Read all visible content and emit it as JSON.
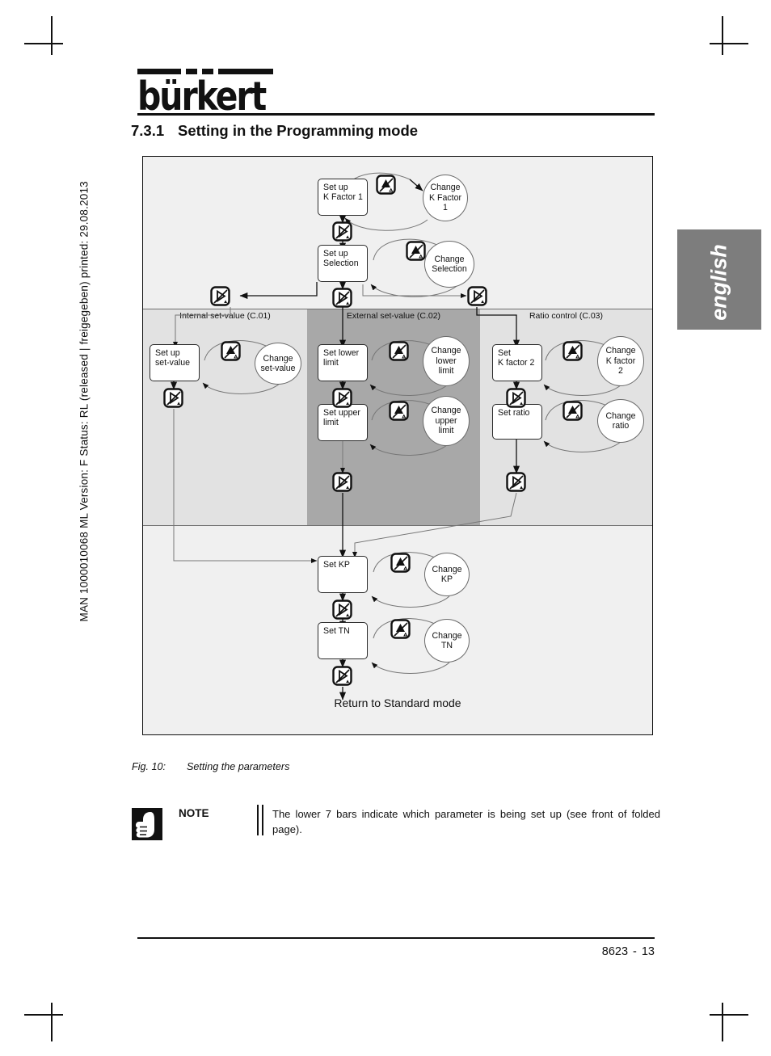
{
  "page": {
    "sidebar_text": "MAN 1000010068  ML  Version: F  Status: RL (released | freigegeben)  printed: 29.08.2013",
    "language_tab": "english",
    "footer_doc": "8623",
    "footer_sep": "-",
    "footer_page": "13",
    "logo_word": "bürkert"
  },
  "heading": {
    "number": "7.3.1",
    "title": "Setting in the Programming mode"
  },
  "caption": {
    "label": "Fig. 10:",
    "text": "Setting the parameters"
  },
  "note": {
    "word": "NOTE",
    "text": "The lower 7 bars indicate which parameter is being set up (see front of folded page).",
    "icon": "hand-thumb-icon"
  },
  "diagram": {
    "return_label": "Return to Standard mode",
    "bands": [
      {
        "label": "Internal set-value (C.01)",
        "shade": "#e2e2e2"
      },
      {
        "label": "External set-value (C.02)",
        "shade": "#a8a8a8"
      },
      {
        "label": "Ratio control (C.03)",
        "shade": "#e2e2e2"
      }
    ],
    "nodes": {
      "setup_kfactor1": "Set up\nK Factor 1",
      "change_kfactor1": "Change\nK Factor\n1",
      "setup_selection": "Set up\nSelection",
      "change_selection": "Change\nSelection",
      "setup_setvalue": "Set up\nset-value",
      "change_setvalue": "Change\nset-value",
      "set_lower_limit": "Set lower\nlimit",
      "change_lower_limit": "Change\nlower\nlimit",
      "set_upper_limit": "Set upper\nlimit",
      "change_upper_limit": "Change\nupper\nlimit",
      "set_kfactor2": "Set\nK factor 2",
      "change_kfactor2": "Change\nK factor\n2",
      "set_ratio": "Set ratio",
      "change_ratio": "Change\nratio",
      "set_kp": "Set KP",
      "change_kp": "Change\nKP",
      "set_tn": "Set TN",
      "change_tn": "Change\nTN"
    },
    "keys": {
      "up_key": "up-triangle-key-icon",
      "enter_key": "right-triangle-enter-key-icon"
    }
  }
}
